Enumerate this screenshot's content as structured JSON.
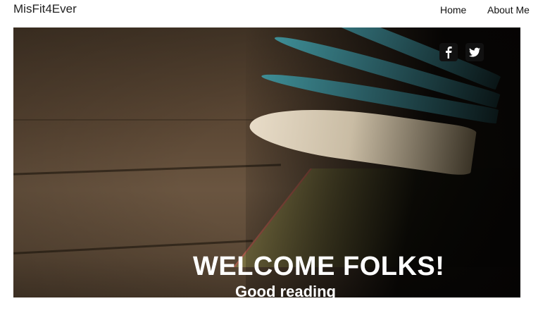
{
  "navbar": {
    "brand": "MisFit4Ever",
    "links": [
      {
        "label": "Home"
      },
      {
        "label": "About Me"
      }
    ]
  },
  "hero": {
    "social": [
      {
        "icon": "facebook-icon"
      },
      {
        "icon": "twitter-icon"
      }
    ],
    "title": "WELCOME FOLKS!",
    "subtitle": "Good reading"
  }
}
